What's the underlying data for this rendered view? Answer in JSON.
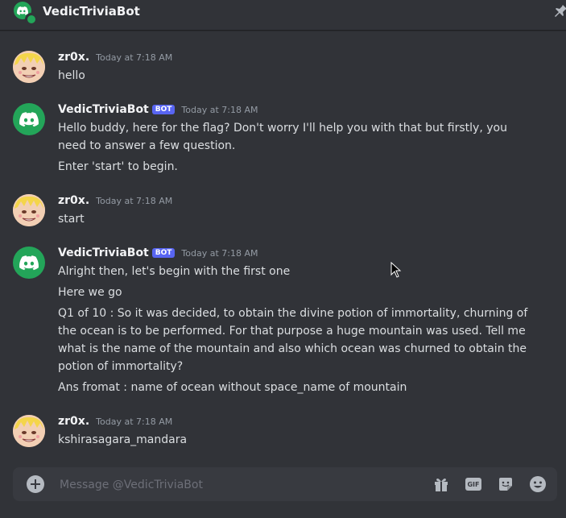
{
  "header": {
    "title": "VedicTriviaBot"
  },
  "messages": [
    {
      "author": "zr0x.",
      "time": "Today at 7:18 AM",
      "is_bot": false,
      "lines": [
        "hello"
      ]
    },
    {
      "author": "VedicTriviaBot",
      "badge": "BOT",
      "time": "Today at 7:18 AM",
      "is_bot": true,
      "lines": [
        "Hello buddy, here for the flag? Don't worry I'll help you with that but firstly, you need to answer a few question.",
        "Enter 'start' to begin."
      ]
    },
    {
      "author": "zr0x.",
      "time": "Today at 7:18 AM",
      "is_bot": false,
      "lines": [
        "start"
      ]
    },
    {
      "author": "VedicTriviaBot",
      "badge": "BOT",
      "time": "Today at 7:18 AM",
      "is_bot": true,
      "lines": [
        "Alright then, let's begin with the first one",
        "Here we go",
        "Q1 of 10 : So it was decided, to obtain the divine potion of immortality, churning of the ocean is to be performed. For that purpose a huge mountain was used. Tell me what is the name of the mountain and also which ocean was churned to obtain the potion of immortality?",
        "Ans fromat : name of ocean without space_name of mountain"
      ]
    },
    {
      "author": "zr0x.",
      "time": "Today at 7:18 AM",
      "is_bot": false,
      "lines": [
        "kshirasagara_mandara"
      ]
    }
  ],
  "composer": {
    "placeholder": "Message @VedicTriviaBot",
    "gif_label": "GIF",
    "icons": [
      "add-icon",
      "gift-icon",
      "gif-icon",
      "sticker-icon",
      "emoji-icon"
    ]
  },
  "colors": {
    "accent": "#5865f2",
    "online": "#23a559",
    "background": "#313338"
  }
}
